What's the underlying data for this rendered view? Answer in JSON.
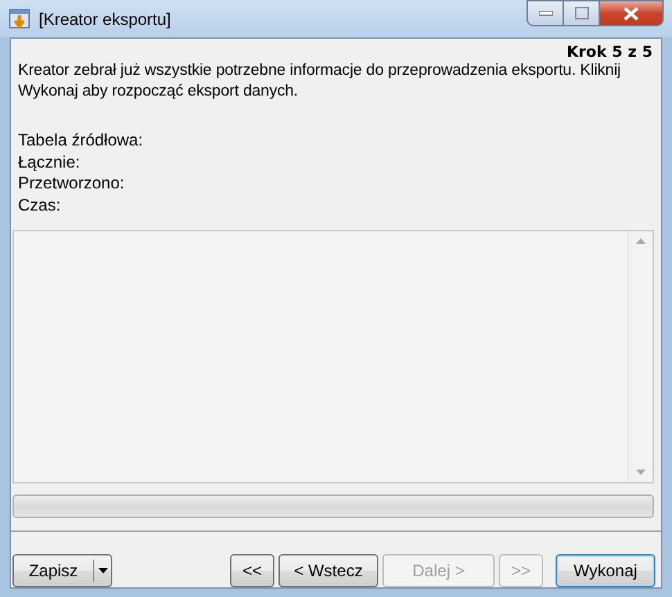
{
  "window": {
    "title": "[Kreator eksportu]"
  },
  "step": "Krok 5 z 5",
  "message": "Kreator zebrał już wszystkie potrzebne informacje do przeprowadzenia eksportu. Kliknij Wykonaj aby rozpocząć eksport danych.",
  "fields": [
    {
      "label": "Tabela źródłowa:"
    },
    {
      "label": "Łącznie:"
    },
    {
      "label": "Przetworzono:"
    },
    {
      "label": "Czas:"
    }
  ],
  "progress": {
    "level": 0
  },
  "buttons": [
    {
      "label": "Zapisz",
      "kind": "split",
      "disabled": false
    },
    {
      "label": "<<",
      "kind": "nav",
      "disabled": false
    },
    {
      "label": "< Wstecz",
      "kind": "nav",
      "disabled": false
    },
    {
      "label": "Dalej >",
      "kind": "nav",
      "disabled": true
    },
    {
      "label": ">>",
      "kind": "nav",
      "disabled": true
    },
    {
      "label": "Wykonaj",
      "kind": "default",
      "disabled": false
    }
  ]
}
